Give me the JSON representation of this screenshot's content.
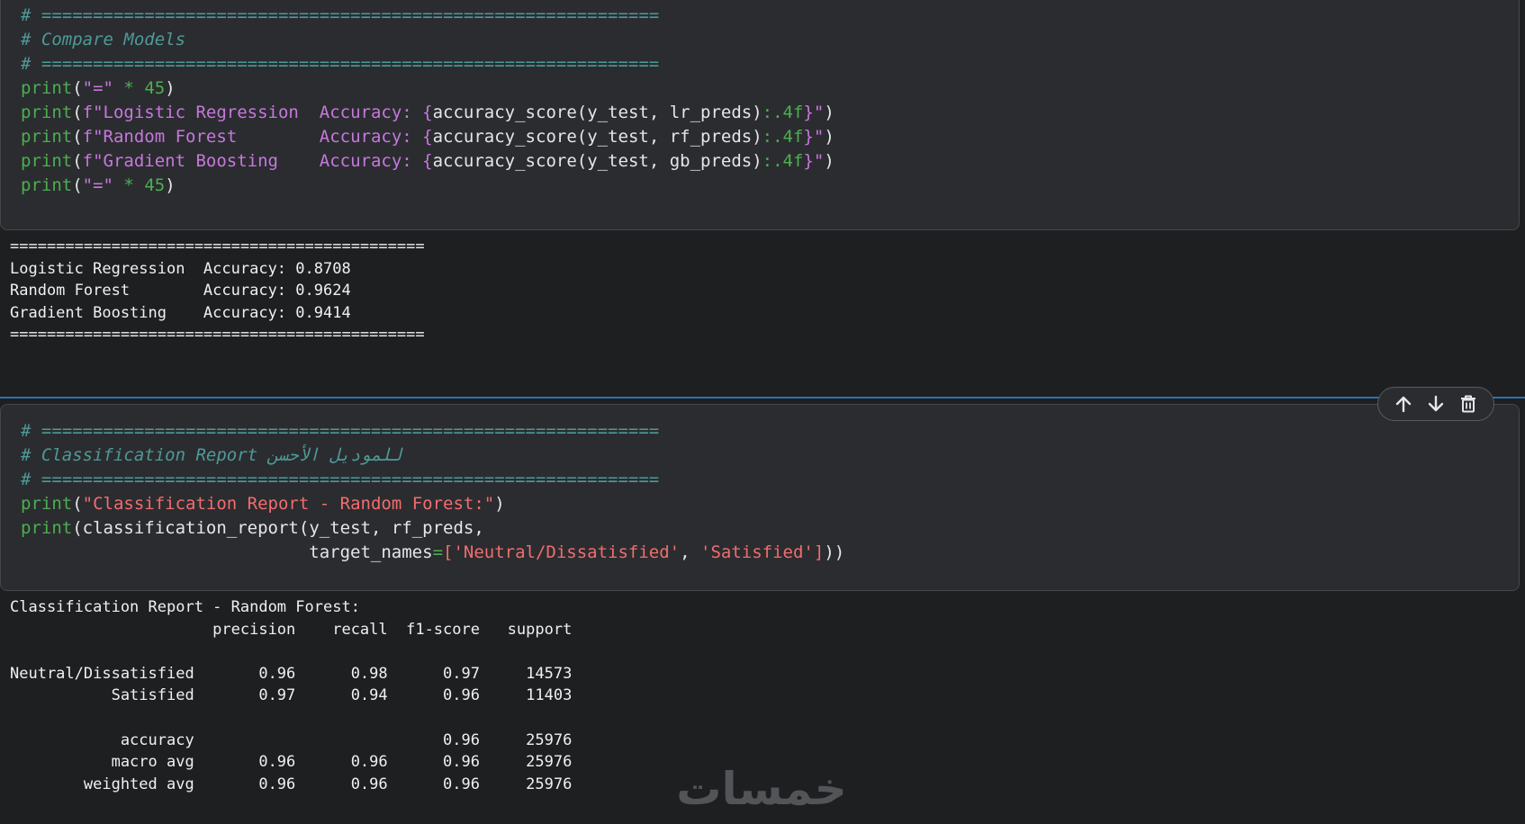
{
  "cells": [
    {
      "code_lines": [
        [
          {
            "t": "# ============================================================",
            "c": "c-com"
          }
        ],
        [
          {
            "t": "# Compare Models",
            "c": "c-com"
          }
        ],
        [
          {
            "t": "# ============================================================",
            "c": "c-com"
          }
        ],
        [
          {
            "t": "print",
            "c": "c-fn"
          },
          {
            "t": "(",
            "c": "c-br"
          },
          {
            "t": "\"=\"",
            "c": "c-str"
          },
          {
            "t": " * ",
            "c": "c-op"
          },
          {
            "t": "45",
            "c": "c-num"
          },
          {
            "t": ")",
            "c": "c-br"
          }
        ],
        [
          {
            "t": "print",
            "c": "c-fn"
          },
          {
            "t": "(",
            "c": "c-br"
          },
          {
            "t": "f\"Logistic Regression  Accuracy: ",
            "c": "c-str"
          },
          {
            "t": "{",
            "c": "c-brace"
          },
          {
            "t": "accuracy_score(y_test, lr_preds)",
            "c": "c-br"
          },
          {
            "t": ":.4f",
            "c": "c-spec"
          },
          {
            "t": "}\"",
            "c": "c-brace"
          },
          {
            "t": ")",
            "c": "c-br"
          }
        ],
        [
          {
            "t": "print",
            "c": "c-fn"
          },
          {
            "t": "(",
            "c": "c-br"
          },
          {
            "t": "f\"Random Forest        Accuracy: ",
            "c": "c-str"
          },
          {
            "t": "{",
            "c": "c-brace"
          },
          {
            "t": "accuracy_score(y_test, rf_preds)",
            "c": "c-br"
          },
          {
            "t": ":.4f",
            "c": "c-spec"
          },
          {
            "t": "}\"",
            "c": "c-brace"
          },
          {
            "t": ")",
            "c": "c-br"
          }
        ],
        [
          {
            "t": "print",
            "c": "c-fn"
          },
          {
            "t": "(",
            "c": "c-br"
          },
          {
            "t": "f\"Gradient Boosting    Accuracy: ",
            "c": "c-str"
          },
          {
            "t": "{",
            "c": "c-brace"
          },
          {
            "t": "accuracy_score(y_test, gb_preds)",
            "c": "c-br"
          },
          {
            "t": ":.4f",
            "c": "c-spec"
          },
          {
            "t": "}\"",
            "c": "c-brace"
          },
          {
            "t": ")",
            "c": "c-br"
          }
        ],
        [
          {
            "t": "print",
            "c": "c-fn"
          },
          {
            "t": "(",
            "c": "c-br"
          },
          {
            "t": "\"=\"",
            "c": "c-str"
          },
          {
            "t": " * ",
            "c": "c-op"
          },
          {
            "t": "45",
            "c": "c-num"
          },
          {
            "t": ")",
            "c": "c-br"
          }
        ]
      ],
      "output_lines": [
        "=============================================",
        "Logistic Regression  Accuracy: 0.8708",
        "Random Forest        Accuracy: 0.9624",
        "Gradient Boosting    Accuracy: 0.9414",
        "============================================="
      ]
    },
    {
      "code_lines": [
        [
          {
            "t": "# ============================================================",
            "c": "c-com"
          }
        ],
        [
          {
            "t": "# Classification Report للموديل الأحسن",
            "c": "c-com"
          }
        ],
        [
          {
            "t": "# ============================================================",
            "c": "c-com"
          }
        ],
        [
          {
            "t": "print",
            "c": "c-fn"
          },
          {
            "t": "(",
            "c": "c-br"
          },
          {
            "t": "\"Classification Report - Random Forest:\"",
            "c": "c-str2"
          },
          {
            "t": ")",
            "c": "c-br"
          }
        ],
        [
          {
            "t": "print",
            "c": "c-fn"
          },
          {
            "t": "(",
            "c": "c-br"
          },
          {
            "t": "classification_report(y_test, rf_preds,",
            "c": "c-br"
          }
        ],
        [
          {
            "t": "                            target_names",
            "c": "c-br"
          },
          {
            "t": "=",
            "c": "c-op"
          },
          {
            "t": "[",
            "c": "c-str2"
          },
          {
            "t": "'Neutral/Dissatisfied'",
            "c": "c-str2"
          },
          {
            "t": ", ",
            "c": "c-br"
          },
          {
            "t": "'Satisfied'",
            "c": "c-str2"
          },
          {
            "t": "]",
            "c": "c-str2"
          },
          {
            "t": "))",
            "c": "c-br"
          }
        ]
      ],
      "output_lines": [
        "Classification Report - Random Forest:",
        "                      precision    recall  f1-score   support",
        "",
        "Neutral/Dissatisfied       0.96      0.98      0.97     14573",
        "           Satisfied       0.97      0.94      0.96     11403",
        "",
        "            accuracy                           0.96     25976",
        "           macro avg       0.96      0.96      0.96     25976",
        "        weighted avg       0.96      0.96      0.96     25976"
      ]
    }
  ],
  "toolbar": {
    "icons": [
      "arrow-up-icon",
      "arrow-down-icon",
      "trash-icon"
    ]
  },
  "watermark": {
    "text": "خمسات"
  },
  "colors": {
    "background": "#1e1f21",
    "cell_bg": "#2b2c30",
    "comment": "#4d9a97",
    "function": "#4caf50",
    "string": "#c678dd",
    "string_red": "#f26d6d",
    "focus_line": "#2f6fb7"
  }
}
